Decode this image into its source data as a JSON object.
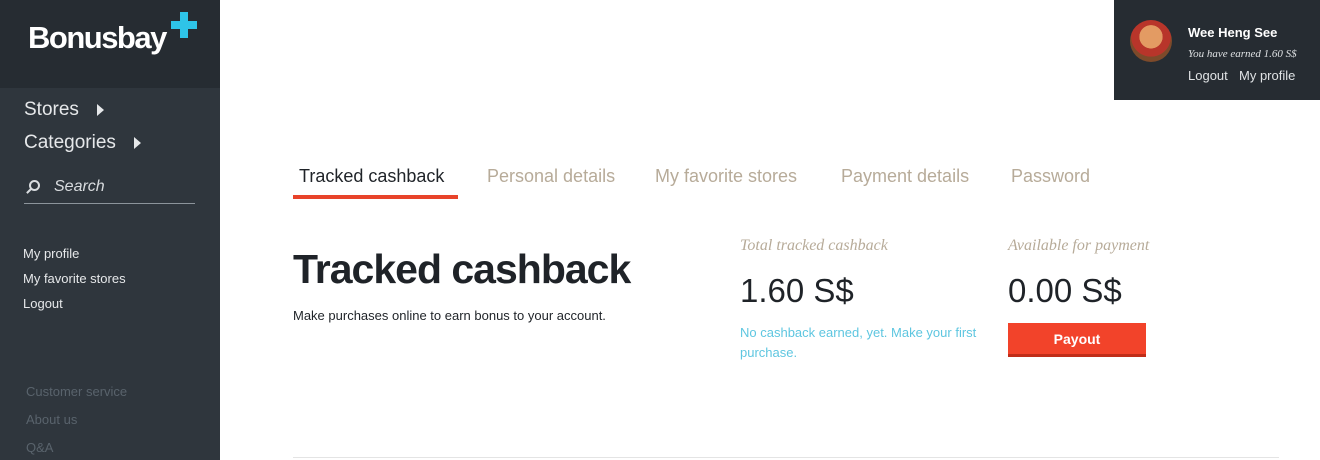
{
  "brand": {
    "name": "Bonusbay"
  },
  "sidebar": {
    "nav": [
      {
        "label": "Stores"
      },
      {
        "label": "Categories"
      }
    ],
    "search_label": "Search",
    "account_links": [
      "My profile",
      "My favorite stores",
      "Logout"
    ],
    "footer_links": [
      "Customer service",
      "About us",
      "Q&A"
    ]
  },
  "user": {
    "name": "Wee Heng See",
    "earned": "You have earned 1.60 S$",
    "logout_label": "Logout",
    "profile_label": "My profile"
  },
  "tabs": [
    {
      "label": "Tracked cashback",
      "active": true
    },
    {
      "label": "Personal details"
    },
    {
      "label": "My favorite stores"
    },
    {
      "label": "Payment details"
    },
    {
      "label": "Password"
    }
  ],
  "main": {
    "title": "Tracked cashback",
    "description": "Make purchases online to earn bonus to your account.",
    "total": {
      "label": "Total tracked cashback",
      "value": "1.60 S$",
      "note": "No cashback earned, yet. Make your first purchase."
    },
    "available": {
      "label": "Available for payment",
      "value": "0.00 S$",
      "button_label": "Payout"
    }
  },
  "colors": {
    "accent": "#e8432a",
    "button": "#f2432a",
    "link_blue": "#5ec6e0",
    "brand_plus": "#2ec4e8",
    "sidebar_bg": "#2f363d"
  },
  "icons": [
    "search-icon",
    "chevron-right-icon",
    "avatar"
  ]
}
